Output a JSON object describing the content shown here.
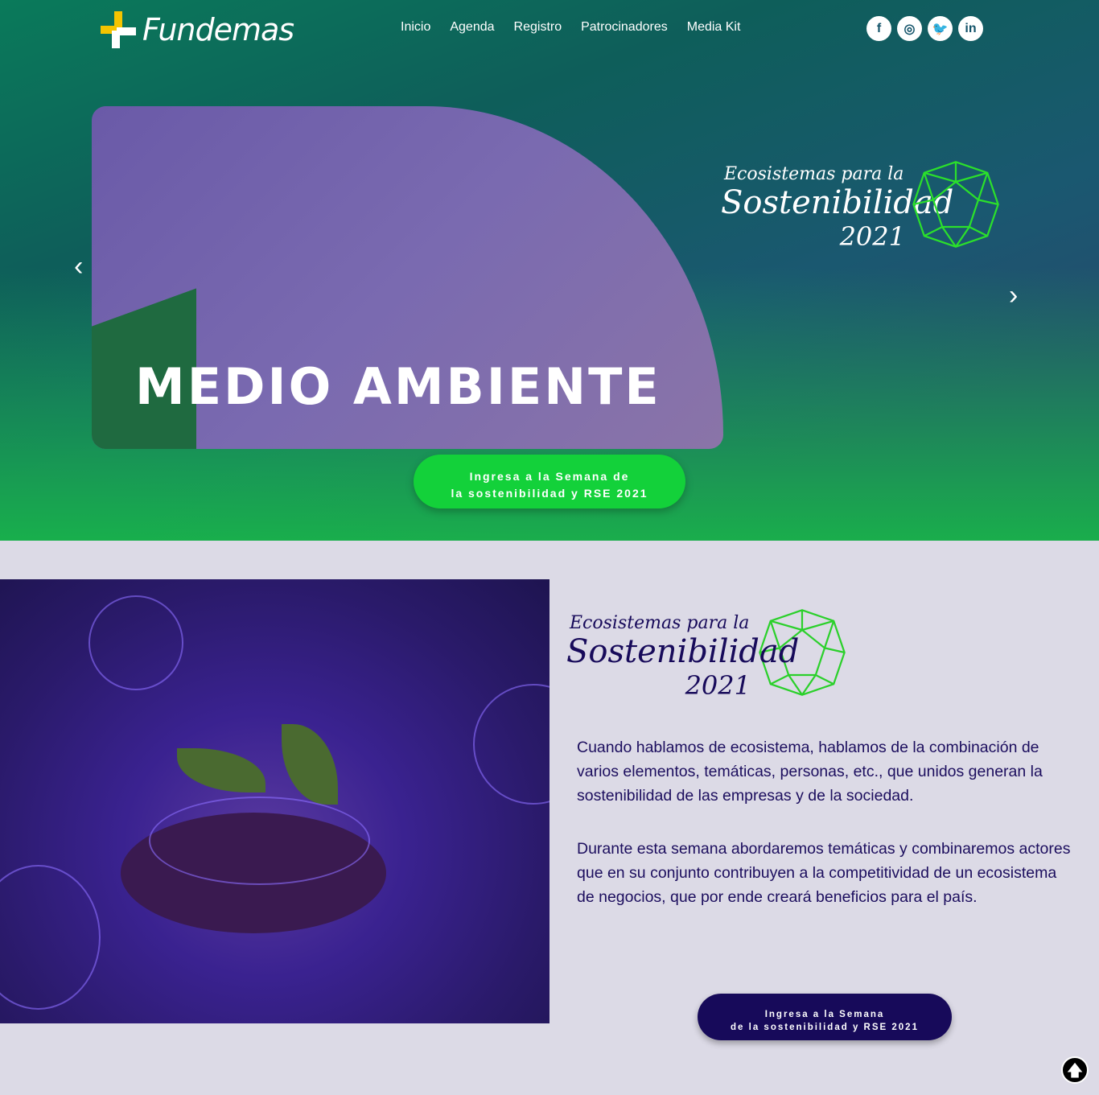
{
  "header": {
    "logo_text": "Fundemas",
    "nav": [
      "Inicio",
      "Agenda",
      "Registro",
      "Patrocinadores",
      "Media Kit"
    ],
    "social": [
      {
        "icon": "facebook-icon",
        "glyph": "f"
      },
      {
        "icon": "instagram-icon",
        "glyph": "◎"
      },
      {
        "icon": "twitter-icon",
        "glyph": "🐦"
      },
      {
        "icon": "linkedin-icon",
        "glyph": "in"
      }
    ]
  },
  "hero": {
    "slide_title": "MEDIO AMBIENTE",
    "prev_glyph": "‹",
    "next_glyph": "›",
    "brand": {
      "line1": "Ecosistemas para la",
      "line2": "Sostenibilidad",
      "line3": "2021"
    },
    "cta_line1": "Ingresa a la Semana de",
    "cta_line2": "la sostenibilidad y RSE 2021"
  },
  "about": {
    "brand": {
      "line1": "Ecosistemas para la",
      "line2": "Sostenibilidad",
      "line3": "2021"
    },
    "paragraphs": [
      "Cuando hablamos de ecosistema, hablamos de la combinación de varios elementos, temáticas, personas, etc., que unidos generan la sostenibilidad de las empresas y de la sociedad.",
      "Durante esta semana abordaremos temáticas y combinaremos actores que en su conjunto contribuyen a la competitividad de un ecosistema de negocios, que por ende creará beneficios para el país."
    ],
    "cta_line1": "Ingresa a la Semana",
    "cta_line2": "de la sostenibilidad y RSE 2021"
  },
  "back_to_top_glyph": "🡅",
  "colors": {
    "accent_green": "#13d13a",
    "navy": "#170a5a",
    "logo_yellow": "#f5c400",
    "section_bg": "#dcdae6"
  }
}
